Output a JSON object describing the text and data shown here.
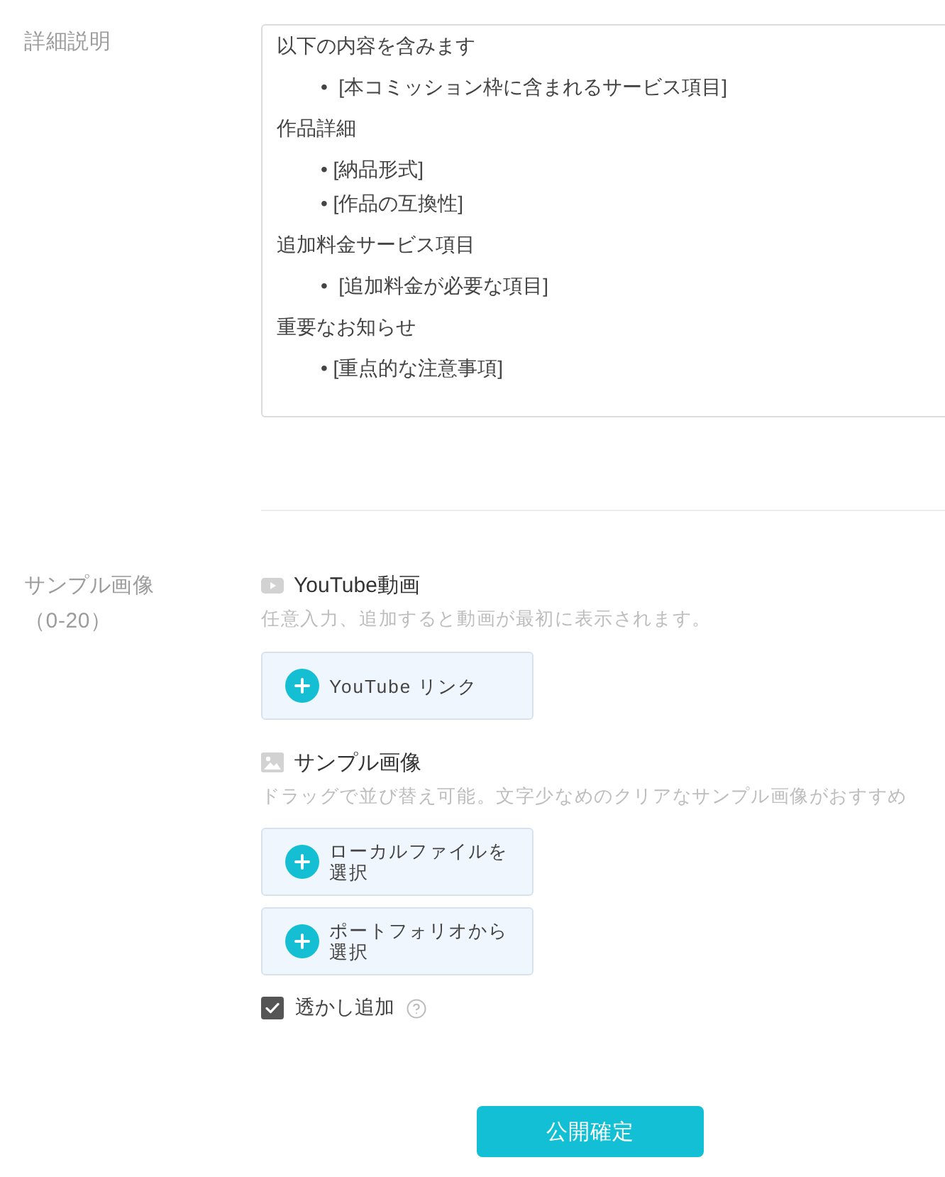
{
  "description": {
    "label": "詳細説明",
    "content": [
      {
        "kind": "paragraph",
        "text": "以下の内容を含みます"
      },
      {
        "kind": "list",
        "items": [
          "•  [本コミッション枠に含まれるサービス項目]"
        ]
      },
      {
        "kind": "paragraph",
        "text": "作品詳細"
      },
      {
        "kind": "list",
        "items": [
          "• [納品形式]",
          "• [作品の互換性]"
        ]
      },
      {
        "kind": "paragraph",
        "text": "追加料金サービス項目"
      },
      {
        "kind": "list",
        "items": [
          "•  [追加料金が必要な項目]"
        ]
      },
      {
        "kind": "paragraph",
        "text": "重要なお知らせ"
      },
      {
        "kind": "list",
        "items": [
          "• [重点的な注意事項]"
        ]
      }
    ]
  },
  "samples": {
    "label": "サンプル画像",
    "range": "（0-20）",
    "sections": [
      {
        "kind": "video",
        "title": "YouTube動画",
        "hint": "任意入力、追加すると動画が最初に表示されます。",
        "buttons": [
          "YouTube リンク"
        ]
      },
      {
        "kind": "image",
        "title": "サンプル画像",
        "hint": "ドラッグで並び替え可能。文字少なめのクリアなサンプル画像がおすすめ",
        "buttons": [
          "ローカルファイルを選択",
          "ポートフォリオから選択"
        ]
      }
    ],
    "watermark": {
      "label": "透かし追加",
      "checked": true
    }
  },
  "submit": "公開確定"
}
